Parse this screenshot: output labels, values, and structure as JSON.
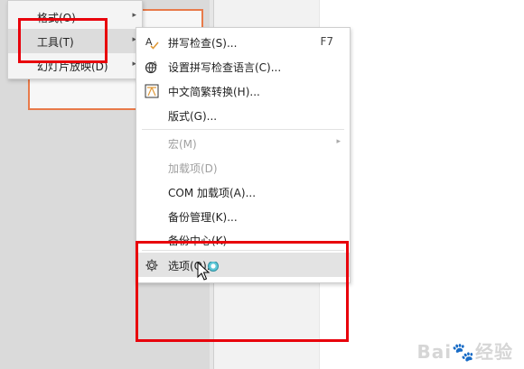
{
  "menu_main": {
    "items": [
      {
        "label": "格式(O)",
        "has_submenu": true
      },
      {
        "label": "工具(T)",
        "has_submenu": true,
        "active": true
      },
      {
        "label": "幻灯片放映(D)",
        "has_submenu": true
      }
    ]
  },
  "menu_tools": {
    "items": [
      {
        "label": "拼写检查(S)...",
        "shortcut": "F7",
        "icon": "spell-check-icon"
      },
      {
        "label": "设置拼写检查语言(C)...",
        "icon": "globe-language-icon"
      },
      {
        "label": "中文简繁转换(H)...",
        "icon": "chinese-convert-icon"
      },
      {
        "label": "版式(G)..."
      },
      {
        "label": "宏(M)",
        "disabled": true,
        "has_submenu": true
      },
      {
        "label": "加载项(D)",
        "disabled": true
      },
      {
        "label": "COM 加载项(A)..."
      },
      {
        "label": "备份管理(K)..."
      },
      {
        "label": "备份中心(K)"
      },
      {
        "label": "选项(O)...",
        "icon": "gear-icon",
        "hovered": true
      }
    ]
  },
  "watermark": {
    "text": "Bai",
    "paw": "🐾",
    "text2": "经验"
  },
  "colors": {
    "highlight": "#e8000b",
    "slide_border": "#e87a4a"
  }
}
